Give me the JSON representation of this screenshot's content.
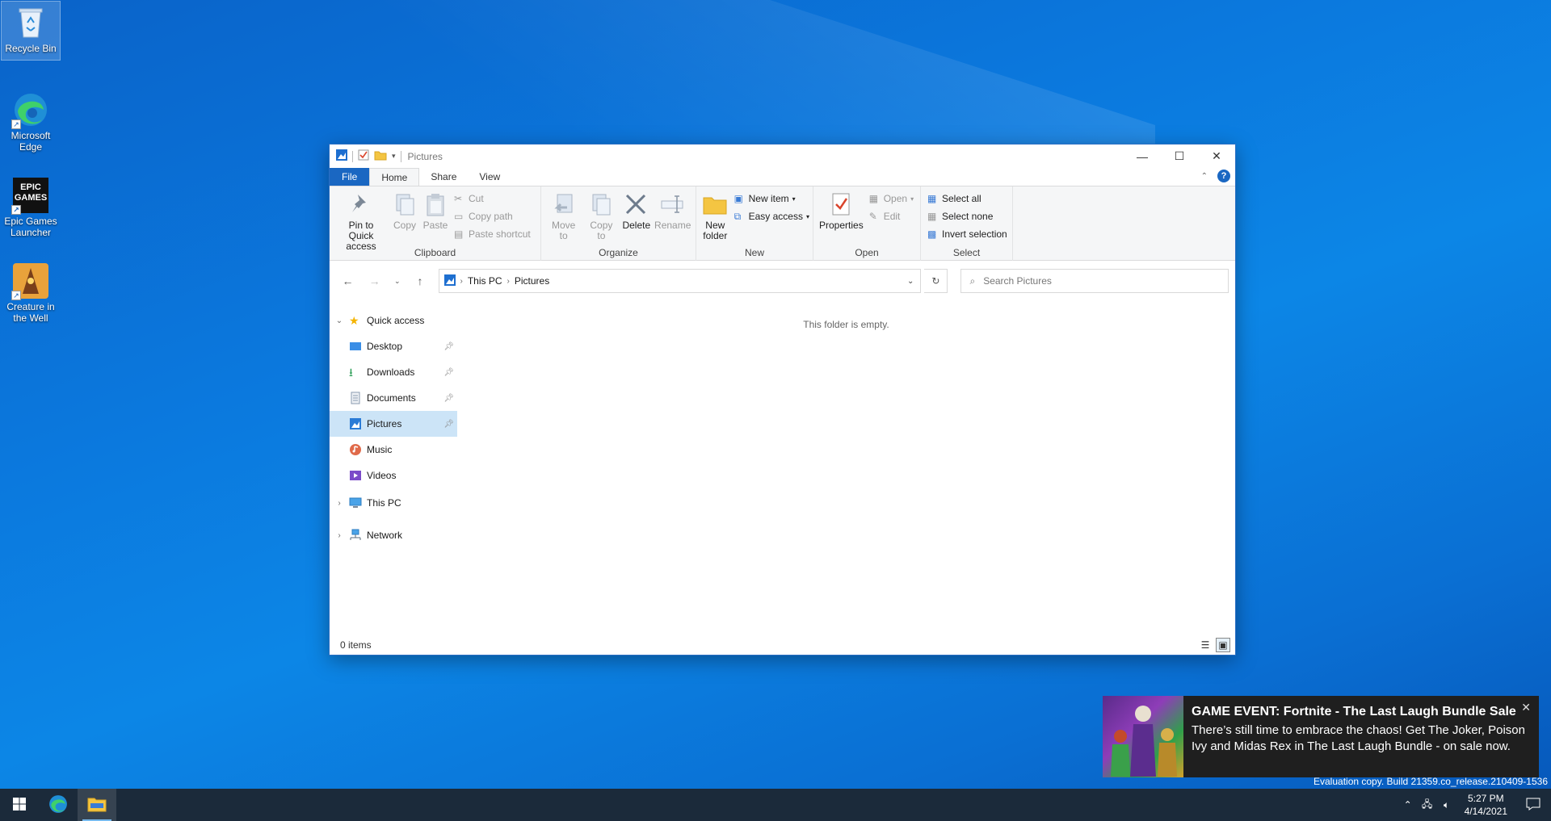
{
  "desktop": {
    "icons": [
      {
        "label": "Recycle Bin"
      },
      {
        "label": "Microsoft Edge"
      },
      {
        "label": "Epic Games Launcher",
        "logo_text": "EPIC GAMES"
      },
      {
        "label": "Creature in the Well"
      }
    ]
  },
  "window": {
    "title": "Pictures",
    "controls": {
      "minimize": "—",
      "maximize": "☐",
      "close": "✕"
    }
  },
  "ribbon": {
    "tabs": [
      {
        "label": "File"
      },
      {
        "label": "Home"
      },
      {
        "label": "Share"
      },
      {
        "label": "View"
      }
    ],
    "help": "?",
    "clipboard": {
      "label": "Clipboard",
      "pin": "Pin to Quick access",
      "copy": "Copy",
      "paste": "Paste",
      "cut": "Cut",
      "copy_path": "Copy path",
      "paste_shortcut": "Paste shortcut"
    },
    "organize": {
      "label": "Organize",
      "move_to": "Move to",
      "copy_to": "Copy to",
      "delete": "Delete",
      "rename": "Rename"
    },
    "new": {
      "label": "New",
      "new_folder": "New folder",
      "new_item": "New item",
      "easy_access": "Easy access"
    },
    "open": {
      "label": "Open",
      "properties": "Properties",
      "open": "Open",
      "edit": "Edit"
    },
    "select": {
      "label": "Select",
      "select_all": "Select all",
      "select_none": "Select none",
      "invert": "Invert selection"
    }
  },
  "address": {
    "crumbs": [
      "This PC",
      "Pictures"
    ],
    "search_placeholder": "Search Pictures"
  },
  "nav": {
    "quick_access": "Quick access",
    "items": [
      {
        "label": "Desktop",
        "icon": "desktop-folder-icon",
        "color": "#3a8ee6"
      },
      {
        "label": "Downloads",
        "icon": "download-icon",
        "color": "#2a9d55"
      },
      {
        "label": "Documents",
        "icon": "documents-icon",
        "color": "#8a9bb0"
      },
      {
        "label": "Pictures",
        "icon": "pictures-icon",
        "color": "#2a7bd6"
      },
      {
        "label": "Music",
        "icon": "music-icon",
        "color": "#e06a4a"
      },
      {
        "label": "Videos",
        "icon": "videos-icon",
        "color": "#7b4bc9"
      }
    ],
    "this_pc": "This PC",
    "network": "Network"
  },
  "content": {
    "empty_message": "This folder is empty."
  },
  "status": {
    "items": "0 items"
  },
  "toast": {
    "title": "GAME EVENT: Fortnite - The Last Laugh Bundle Sale",
    "body": "There’s still time to embrace the chaos! Get The Joker, Poison Ivy and Midas Rex in The Last Laugh Bundle - on sale now.",
    "close": "✕"
  },
  "watermark": {
    "line2": "Evaluation copy. Build 21359.co_release.210409-1536"
  },
  "taskbar": {
    "time": "5:27 PM",
    "date": "4/14/2021"
  },
  "colors": {
    "accent": "#1a67c2",
    "selection": "#cce4f7",
    "taskbar": "#1b2a3a"
  }
}
